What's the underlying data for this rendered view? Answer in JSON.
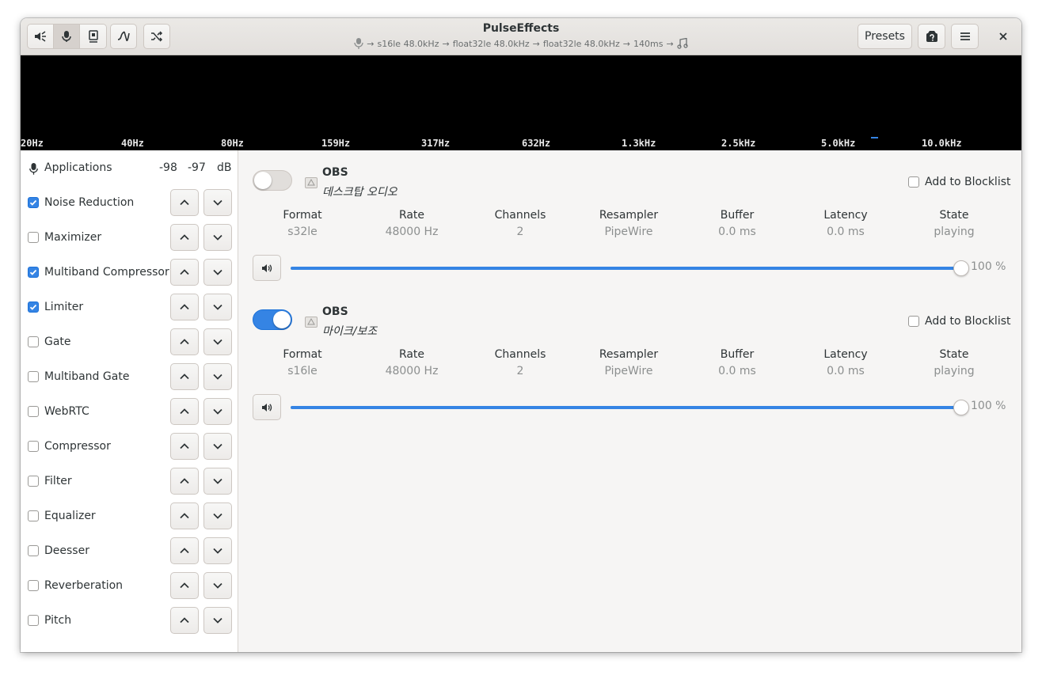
{
  "window": {
    "title": "PulseEffects",
    "pipeline": [
      "s16le 48.0kHz",
      "float32le 48.0kHz",
      "float32le 48.0kHz",
      "140ms"
    ],
    "pipeline_separator": "→"
  },
  "headerbar": {
    "mode_buttons": [
      {
        "name": "speaker-mode",
        "icon": "speaker-icon",
        "active": false
      },
      {
        "name": "microphone-mode",
        "icon": "microphone-icon",
        "active": true
      },
      {
        "name": "device-mode",
        "icon": "device-icon",
        "active": false
      }
    ],
    "presets_label": "Presets"
  },
  "spectrum": {
    "frequency_labels": [
      "20Hz",
      "40Hz",
      "80Hz",
      "159Hz",
      "317Hz",
      "632Hz",
      "1.3kHz",
      "2.5kHz",
      "5.0kHz",
      "10.0kHz"
    ]
  },
  "sidebar": {
    "applications": {
      "label": "Applications",
      "level_left": "-98",
      "level_right": "-97",
      "unit": "dB"
    },
    "plugins": [
      {
        "label": "Noise Reduction",
        "checked": true
      },
      {
        "label": "Maximizer",
        "checked": false
      },
      {
        "label": "Multiband Compressor",
        "checked": true
      },
      {
        "label": "Limiter",
        "checked": true
      },
      {
        "label": "Gate",
        "checked": false
      },
      {
        "label": "Multiband Gate",
        "checked": false
      },
      {
        "label": "WebRTC",
        "checked": false
      },
      {
        "label": "Compressor",
        "checked": false
      },
      {
        "label": "Filter",
        "checked": false
      },
      {
        "label": "Equalizer",
        "checked": false
      },
      {
        "label": "Deesser",
        "checked": false
      },
      {
        "label": "Reverberation",
        "checked": false
      },
      {
        "label": "Pitch",
        "checked": false
      }
    ]
  },
  "columns": [
    "Format",
    "Rate",
    "Channels",
    "Resampler",
    "Buffer",
    "Latency",
    "State"
  ],
  "streams": [
    {
      "name": "OBS",
      "description": "데스크탑 오디오",
      "enabled": false,
      "blocklist_label": "Add to Blocklist",
      "blocklisted": false,
      "values": [
        "s32le",
        "48000 Hz",
        "2",
        "PipeWire",
        "0.0 ms",
        "0.0 ms",
        "playing"
      ],
      "volume": 100,
      "volume_label": "100 %"
    },
    {
      "name": "OBS",
      "description": "마이크/보조",
      "enabled": true,
      "blocklist_label": "Add to Blocklist",
      "blocklisted": false,
      "values": [
        "s16le",
        "48000 Hz",
        "2",
        "PipeWire",
        "0.0 ms",
        "0.0 ms",
        "playing"
      ],
      "volume": 100,
      "volume_label": "100 %"
    }
  ],
  "colors": {
    "accent": "#3584e4",
    "spectrum_bg": "#000000",
    "muted_text": "#8c8f8f"
  }
}
